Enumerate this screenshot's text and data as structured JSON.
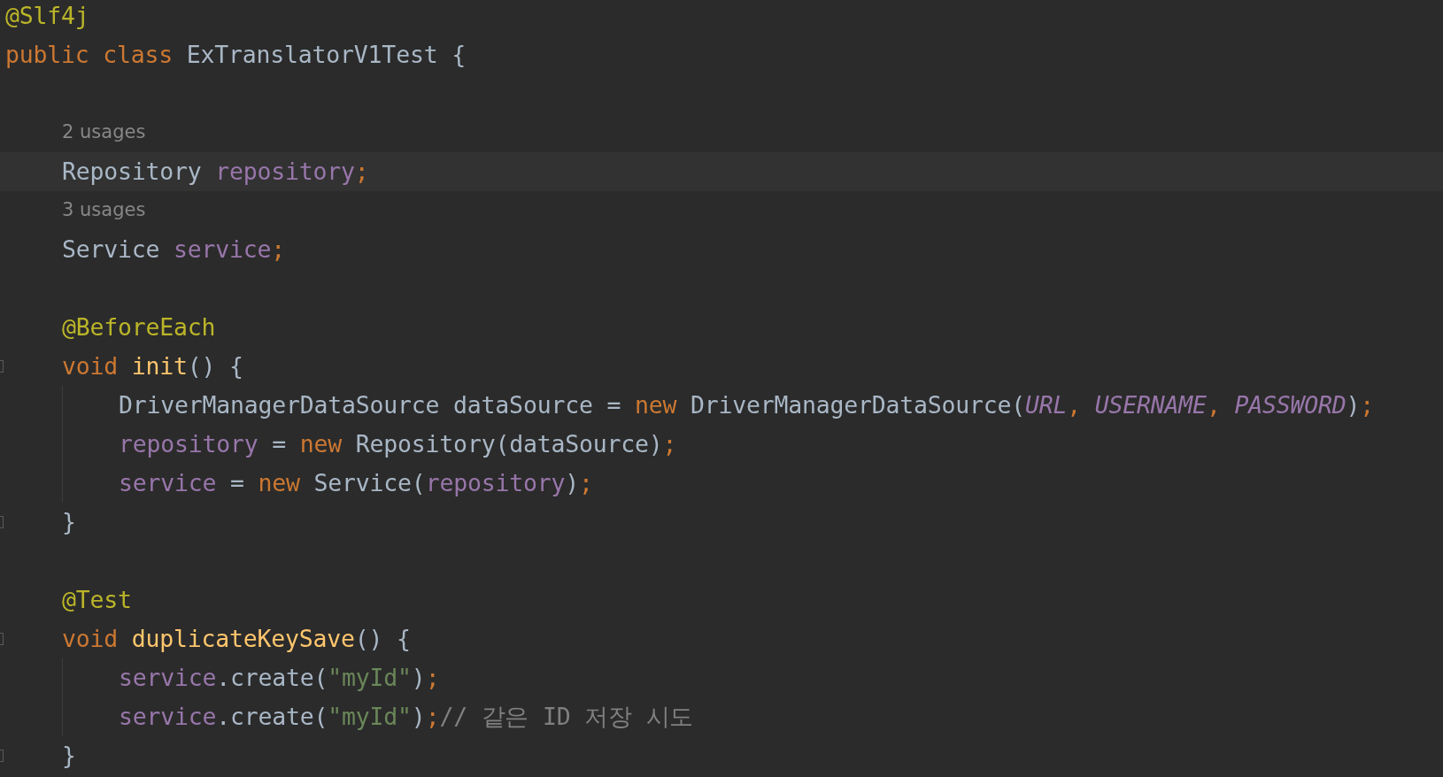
{
  "editor": {
    "lines": [
      {
        "kind": "code",
        "tokens": [
          {
            "kind": "annotation",
            "text": "@Slf4j"
          }
        ]
      },
      {
        "kind": "code",
        "tokens": [
          {
            "kind": "keyword",
            "text": "public class "
          },
          {
            "kind": "plain",
            "text": "ExTranslatorV1Test {"
          }
        ],
        "children": [
          {
            "kind": "blank"
          },
          {
            "kind": "hint",
            "text": "2 usages"
          },
          {
            "kind": "code",
            "highlighted": true,
            "tokens": [
              {
                "kind": "plain",
                "text": "Repository "
              },
              {
                "kind": "field",
                "text": "repository"
              },
              {
                "kind": "punct",
                "text": ";"
              }
            ]
          },
          {
            "kind": "hint",
            "text": "3 usages"
          },
          {
            "kind": "code",
            "tokens": [
              {
                "kind": "plain",
                "text": "Service "
              },
              {
                "kind": "field",
                "text": "service"
              },
              {
                "kind": "punct",
                "text": ";"
              }
            ]
          },
          {
            "kind": "blank"
          },
          {
            "kind": "code",
            "tokens": [
              {
                "kind": "annotation",
                "text": "@BeforeEach"
              }
            ]
          },
          {
            "kind": "code",
            "fold_marker": true,
            "tokens": [
              {
                "kind": "keyword",
                "text": "void "
              },
              {
                "kind": "method",
                "text": "init"
              },
              {
                "kind": "plain",
                "text": "() {"
              }
            ],
            "children": [
              {
                "kind": "code",
                "tokens": [
                  {
                    "kind": "plain",
                    "text": "DriverManagerDataSource dataSource = "
                  },
                  {
                    "kind": "keyword",
                    "text": "new "
                  },
                  {
                    "kind": "plain",
                    "text": "DriverManagerDataSource("
                  },
                  {
                    "kind": "constant",
                    "text": "URL"
                  },
                  {
                    "kind": "punct",
                    "text": ", "
                  },
                  {
                    "kind": "constant",
                    "text": "USERNAME"
                  },
                  {
                    "kind": "punct",
                    "text": ", "
                  },
                  {
                    "kind": "constant",
                    "text": "PASSWORD"
                  },
                  {
                    "kind": "plain",
                    "text": ")"
                  },
                  {
                    "kind": "punct",
                    "text": ";"
                  }
                ]
              },
              {
                "kind": "code",
                "tokens": [
                  {
                    "kind": "field",
                    "text": "repository"
                  },
                  {
                    "kind": "plain",
                    "text": " = "
                  },
                  {
                    "kind": "keyword",
                    "text": "new "
                  },
                  {
                    "kind": "plain",
                    "text": "Repository(dataSource)"
                  },
                  {
                    "kind": "punct",
                    "text": ";"
                  }
                ]
              },
              {
                "kind": "code",
                "tokens": [
                  {
                    "kind": "field",
                    "text": "service"
                  },
                  {
                    "kind": "plain",
                    "text": " = "
                  },
                  {
                    "kind": "keyword",
                    "text": "new "
                  },
                  {
                    "kind": "plain",
                    "text": "Service("
                  },
                  {
                    "kind": "field",
                    "text": "repository"
                  },
                  {
                    "kind": "plain",
                    "text": ")"
                  },
                  {
                    "kind": "punct",
                    "text": ";"
                  }
                ]
              }
            ]
          },
          {
            "kind": "code",
            "fold_marker": true,
            "tokens": [
              {
                "kind": "plain",
                "text": "}"
              }
            ]
          },
          {
            "kind": "blank"
          },
          {
            "kind": "code",
            "tokens": [
              {
                "kind": "annotation",
                "text": "@Test"
              }
            ]
          },
          {
            "kind": "code",
            "fold_marker": true,
            "tokens": [
              {
                "kind": "keyword",
                "text": "void "
              },
              {
                "kind": "method",
                "text": "duplicateKeySave"
              },
              {
                "kind": "plain",
                "text": "() {"
              }
            ],
            "children": [
              {
                "kind": "code",
                "tokens": [
                  {
                    "kind": "field",
                    "text": "service"
                  },
                  {
                    "kind": "plain",
                    "text": ".create("
                  },
                  {
                    "kind": "string",
                    "text": "\"myId\""
                  },
                  {
                    "kind": "plain",
                    "text": ")"
                  },
                  {
                    "kind": "punct",
                    "text": ";"
                  }
                ]
              },
              {
                "kind": "code",
                "tokens": [
                  {
                    "kind": "field",
                    "text": "service"
                  },
                  {
                    "kind": "plain",
                    "text": ".create("
                  },
                  {
                    "kind": "string",
                    "text": "\"myId\""
                  },
                  {
                    "kind": "plain",
                    "text": ")"
                  },
                  {
                    "kind": "punct",
                    "text": ";"
                  },
                  {
                    "kind": "comment",
                    "text": "// 같은 ID 저장 시도"
                  }
                ]
              }
            ]
          },
          {
            "kind": "code",
            "fold_marker": true,
            "tokens": [
              {
                "kind": "plain",
                "text": "}"
              }
            ]
          }
        ]
      }
    ]
  }
}
